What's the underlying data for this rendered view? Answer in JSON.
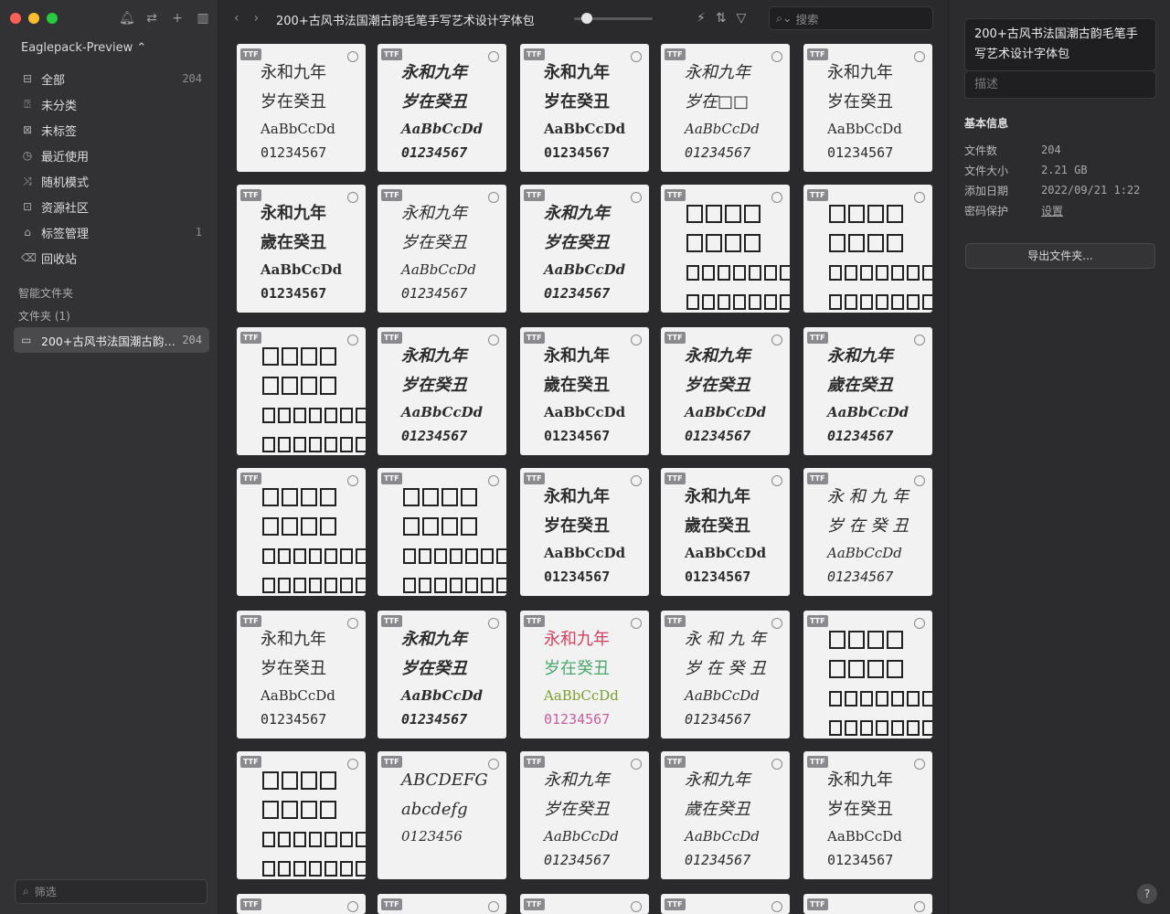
{
  "colors": {
    "red": "#fe5f57",
    "yellow": "#febc2e",
    "green": "#28c840",
    "accent": "#4a4a4d"
  },
  "sidebar": {
    "library_name": "Eaglepack-Preview ⌃",
    "nav": [
      {
        "label": "全部",
        "count": "204",
        "icon": "inbox-icon"
      },
      {
        "label": "未分类",
        "count": "",
        "icon": "question-square-icon"
      },
      {
        "label": "未标签",
        "count": "",
        "icon": "untagged-icon"
      },
      {
        "label": "最近使用",
        "count": "",
        "icon": "clock-icon"
      },
      {
        "label": "随机模式",
        "count": "",
        "icon": "shuffle-icon"
      },
      {
        "label": "资源社区",
        "count": "",
        "icon": "community-icon"
      },
      {
        "label": "标签管理",
        "count": "1",
        "icon": "tag-icon"
      },
      {
        "label": "回收站",
        "count": "",
        "icon": "trash-icon"
      }
    ],
    "smart_folders_label": "智能文件夹",
    "folders_label": "文件夹 (1)",
    "folder": {
      "name": "200+古风书法国潮古韵毛笔手写艺术设计字体包",
      "count": "204"
    },
    "filter_placeholder": "筛选"
  },
  "toolbar": {
    "title": "200+古风书法国潮古韵毛笔手写艺术设计字体包",
    "search_placeholder": "搜索"
  },
  "cards": [
    {
      "type": "glyph",
      "lines": [
        "永和九年",
        "岁在癸丑",
        "AaBbCcDd",
        "01234567"
      ],
      "style": ""
    },
    {
      "type": "glyph",
      "lines": [
        "永和九年",
        "岁在癸丑",
        "AaBbCcDd",
        "01234567"
      ],
      "style": "bold italic"
    },
    {
      "type": "glyph",
      "lines": [
        "永和九年",
        "岁在癸丑",
        "AaBbCcDd",
        "01234567"
      ],
      "style": "bold"
    },
    {
      "type": "glyph",
      "lines": [
        "永和九年",
        "岁在□□",
        "AaBbCcDd",
        "01234567"
      ],
      "style": "italic"
    },
    {
      "type": "glyph",
      "lines": [
        "永和九年",
        "岁在癸丑",
        "AaBbCcDd",
        "01234567"
      ],
      "style": ""
    },
    {
      "type": "glyph",
      "lines": [
        "永和九年",
        "歲在癸丑",
        "AaBbCcDd",
        "01234567"
      ],
      "style": "bold"
    },
    {
      "type": "glyph",
      "lines": [
        "永和九年",
        "岁在癸丑",
        "AaBbCcDd",
        "01234567"
      ],
      "style": "italic"
    },
    {
      "type": "glyph",
      "lines": [
        "永和九年",
        "岁在癸丑",
        "AaBbCcDd",
        "01234567"
      ],
      "style": "bold italic"
    },
    {
      "type": "boxes"
    },
    {
      "type": "boxes"
    },
    {
      "type": "boxes"
    },
    {
      "type": "glyph",
      "lines": [
        "永和九年",
        "岁在癸丑",
        "AaBbCcDd",
        "01234567"
      ],
      "style": "bold italic"
    },
    {
      "type": "glyph",
      "lines": [
        "永和九年",
        "歲在癸丑",
        "AaBbCcDd",
        "01234567"
      ],
      "style": "bold"
    },
    {
      "type": "glyph",
      "lines": [
        "永和九年",
        "岁在癸丑",
        "AaBbCcDd",
        "01234567"
      ],
      "style": "bold italic"
    },
    {
      "type": "glyph",
      "lines": [
        "永和九年",
        "歲在癸丑",
        "AaBbCcDd",
        "01234567"
      ],
      "style": "bold italic"
    },
    {
      "type": "boxes"
    },
    {
      "type": "boxes"
    },
    {
      "type": "glyph",
      "lines": [
        "永和九年",
        "岁在癸丑",
        "AaBbCcDd",
        "01234567"
      ],
      "style": "bold"
    },
    {
      "type": "glyph",
      "lines": [
        "永和九年",
        "歲在癸丑",
        "AaBbCcDd",
        "01234567"
      ],
      "style": "bold"
    },
    {
      "type": "glyph",
      "lines": [
        "永 和 九 年",
        "岁 在 癸 丑",
        "AaBbCcDd",
        "01234567"
      ],
      "style": "italic"
    },
    {
      "type": "glyph",
      "lines": [
        "永和九年",
        "岁在癸丑",
        "AaBbCcDd",
        "01234567"
      ],
      "style": ""
    },
    {
      "type": "glyph",
      "lines": [
        "永和九年",
        "岁在癸丑",
        "AaBbCcDd",
        "01234567"
      ],
      "style": "bold italic"
    },
    {
      "type": "glyph",
      "lines": [
        "永和九年",
        "岁在癸丑",
        "AaBbCcDd",
        "01234567"
      ],
      "style": "colorful"
    },
    {
      "type": "glyph",
      "lines": [
        "永 和 九 年",
        "岁 在 癸 丑",
        "AaBbCcDd",
        "01234567"
      ],
      "style": "italic"
    },
    {
      "type": "boxes"
    },
    {
      "type": "boxes"
    },
    {
      "type": "glyph",
      "lines": [
        "ABCDEFG",
        "abcdefg",
        "0123456",
        ""
      ],
      "style": "italic"
    },
    {
      "type": "glyph",
      "lines": [
        "永和九年",
        "岁在癸丑",
        "AaBbCcDd",
        "01234567"
      ],
      "style": "italic"
    },
    {
      "type": "glyph",
      "lines": [
        "永和九年",
        "歲在癸丑",
        "AaBbCcDd",
        "01234567"
      ],
      "style": "italic"
    },
    {
      "type": "glyph",
      "lines": [
        "永和九年",
        "岁在癸丑",
        "AaBbCcDd",
        "01234567"
      ],
      "style": ""
    },
    {
      "type": "partial"
    },
    {
      "type": "partial"
    },
    {
      "type": "partial"
    },
    {
      "type": "partial"
    },
    {
      "type": "partial"
    }
  ],
  "badge_label": "TTF",
  "box_row_a": 4,
  "box_row_b": 8,
  "right": {
    "title": "200+古风书法国潮古韵毛笔手写艺术设计字体包",
    "desc_placeholder": "描述",
    "section": "基本信息",
    "info": [
      {
        "k": "文件数",
        "v": "204"
      },
      {
        "k": "文件大小",
        "v": "2.21 GB"
      },
      {
        "k": "添加日期",
        "v": "2022/09/21 1:22"
      },
      {
        "k": "密码保护",
        "v": "设置"
      }
    ],
    "export_label": "导出文件夹...",
    "help_label": "?"
  }
}
